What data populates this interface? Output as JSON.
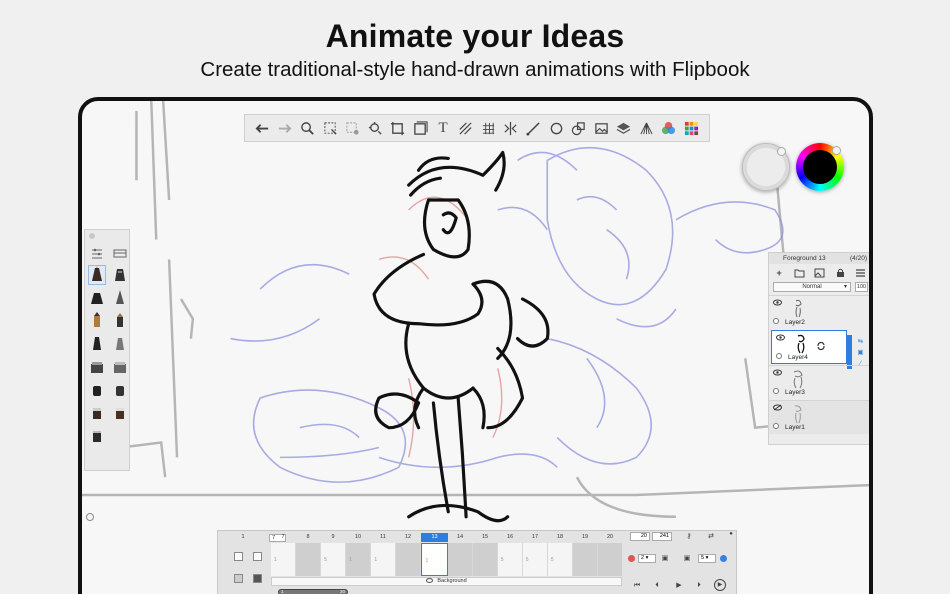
{
  "header": {
    "title": "Animate your Ideas",
    "subtitle": "Create traditional-style hand-drawn animations with Flipbook"
  },
  "toolbar": {
    "tools": [
      "undo-icon",
      "redo-icon",
      "zoom-icon",
      "select-rect-icon",
      "select-lasso-icon",
      "move-icon",
      "crop-icon",
      "stamp-icon",
      "text-icon",
      "hatch-icon",
      "grid-icon",
      "symmetry-icon",
      "line-icon",
      "ellipse-icon",
      "shape-icon",
      "image-icon",
      "layers-icon",
      "perspective-icon",
      "color-wheel-icon",
      "palette-icon"
    ],
    "text_tool_label": "T"
  },
  "colors": {
    "accent": "#2f7de1",
    "primary_swatch": "#000000",
    "secondary_swatch": "#e8e8e8"
  },
  "layers_panel": {
    "title": "Foreground 13",
    "count": "(4/20)",
    "blend_mode": "Normal",
    "opacity": "100",
    "layers": [
      {
        "name": "Layer2",
        "visible": true,
        "active": false
      },
      {
        "name": "Layer4",
        "visible": true,
        "active": true
      },
      {
        "name": "Layer3",
        "visible": true,
        "active": false
      },
      {
        "name": "Layer1",
        "visible": false,
        "active": false
      }
    ]
  },
  "timeline": {
    "start_frame": "1",
    "frame_input": "7",
    "ruler": [
      "7",
      "8",
      "9",
      "10",
      "11",
      "12",
      "13",
      "14",
      "15",
      "16",
      "17",
      "18",
      "19",
      "20"
    ],
    "current_frame": "13",
    "cells": [
      "1",
      "",
      "5",
      "1",
      "1",
      "",
      "1",
      "",
      "",
      "5",
      "5",
      "5",
      "",
      ""
    ],
    "range_start": "20",
    "range_end": "241",
    "background_label": "Background",
    "onion_before": "2",
    "onion_after": "5",
    "scroll_label_start": "1",
    "scroll_label_end": "20"
  }
}
